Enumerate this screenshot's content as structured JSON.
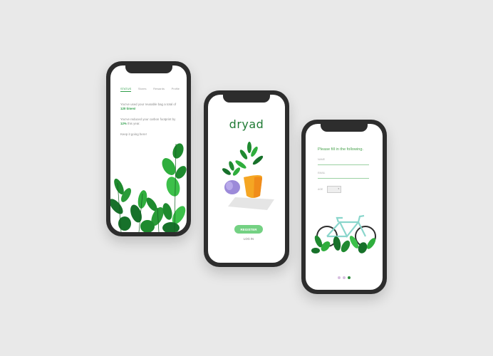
{
  "status_screen": {
    "tabs": [
      "STATUS",
      "Stores",
      "Rewards",
      "Profile"
    ],
    "active_tab": "STATUS",
    "line1_prefix": "You've used your reusable bag a total of ",
    "line1_bold": "120 times!",
    "line2_prefix": "You've reduced your carbon footprint by ",
    "line2_bold": "12%",
    "line2_suffix": " this year.",
    "line3": "Keep it going here!"
  },
  "welcome_screen": {
    "app_name": "dryad",
    "register_label": "REGISTER",
    "login_label": "LOG IN"
  },
  "form_screen": {
    "title": "Please fill in the following.",
    "name_label": "NAME",
    "email_label": "EMAIL",
    "age_label": "AGE",
    "age_value": "▾",
    "page_indicator": {
      "count": 3,
      "active": 3
    }
  },
  "colors": {
    "accent": "#2e9e4a",
    "button": "#74d183",
    "phone": "#2d2d2d"
  }
}
